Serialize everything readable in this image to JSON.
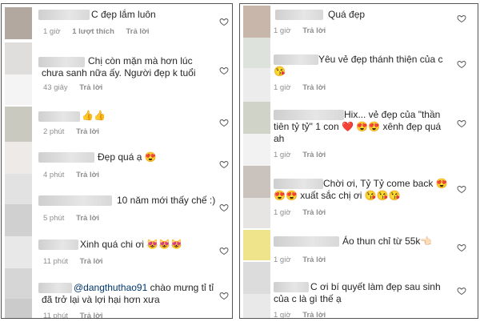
{
  "left": {
    "comments": [
      {
        "text": "C đẹp lắm luôn",
        "time": "1 giờ",
        "likes": "1 lượt thích",
        "reply": "Trả lời"
      },
      {
        "text": "Chị còn mặn mà hơn lúc chưa sanh nữa ấy. Người đẹp k tuổi",
        "time": "43 giây",
        "reply": "Trả lời"
      },
      {
        "text": "👍👍",
        "time": "2 phút",
        "reply": "Trả lời"
      },
      {
        "text": "Đẹp quá ạ 😍",
        "time": "4 phút",
        "reply": "Trả lời"
      },
      {
        "text": "10 năm mới thấy chế :)",
        "time": "5 phút",
        "reply": "Trả lời"
      },
      {
        "text": "Xinh quá chi ơi 😻😻😻",
        "time": "11 phút",
        "reply": "Trả lời"
      },
      {
        "mention": "@dangthuthao91",
        "text": " chào mưng tỉ tỉ đã trở lại và lợi hại hơn xưa",
        "time": "11 phút",
        "reply": "Trả lời"
      }
    ]
  },
  "right": {
    "comments": [
      {
        "text": "Quá đẹp",
        "time": "1 giờ",
        "reply": "Trả lời"
      },
      {
        "text": "Yêu vẻ đẹp thánh thiện của c 😘",
        "time": "1 giờ",
        "reply": "Trả lời"
      },
      {
        "text": "Hix... vẻ đẹp của \"thần tiên tỷ tỷ\" 1 con ❤️ 😍😍 xênh đẹp quá ah",
        "time": "1 giờ",
        "reply": "Trả lời"
      },
      {
        "text": "Chời ơi, Tỷ Tỷ come back 😍 😍😍 xuất sắc chị ơi 😘😘😘",
        "time": "1 giờ",
        "reply": "Trả lời"
      },
      {
        "text": "Áo thun chỉ từ 55k👈🏻",
        "time": "1 giờ",
        "reply": "Trả lời"
      },
      {
        "text": "C ơi bí quyết làm đẹp sau sinh của c là gì thế ạ",
        "time": "1 giờ",
        "reply": "Trả lời"
      }
    ]
  },
  "colors": {
    "text": "#262626",
    "meta": "#8e8e8e",
    "mention": "#00376b"
  },
  "icons": {
    "like": "heart-outline-icon"
  }
}
